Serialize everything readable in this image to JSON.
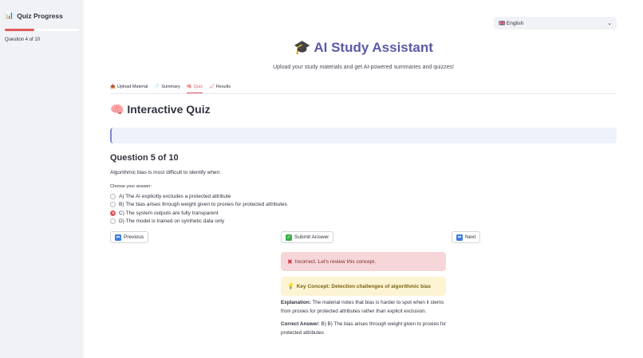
{
  "sidebar": {
    "title": "Quiz Progress",
    "title_icon": "bar-chart-icon",
    "progress_fraction": 0.4,
    "progress_text": "Question 4 of 10"
  },
  "language": {
    "flag": "🇬🇧",
    "selected": "English"
  },
  "header": {
    "icon": "🎓",
    "title": "AI Study Assistant",
    "subtitle": "Upload your study materials and get AI-powered summaries and quizzes!"
  },
  "tabs": [
    {
      "icon": "📤",
      "label": "Upload Material",
      "active": false
    },
    {
      "icon": "📄",
      "label": "Summary",
      "active": false
    },
    {
      "icon": "🧠",
      "label": "Quiz",
      "active": true
    },
    {
      "icon": "📈",
      "label": "Results",
      "active": false
    }
  ],
  "quiz": {
    "section_icon": "🧠",
    "section_title": "Interactive Quiz",
    "question_title": "Question 5 of 10",
    "question_text": "Algorithmic bias is most difficult to identify when:",
    "choose_label": "Choose your answer:",
    "options": [
      "A) The AI explicitly excludes a protected attribute",
      "B) The bias arises through weight given to proxies for protected attributes",
      "C) The system outputs are fully transparent",
      "D) The model is trained on synthetic data only"
    ],
    "selected_index": 2
  },
  "buttons": {
    "previous": "Previous",
    "submit": "Submit Answer",
    "next": "Next"
  },
  "feedback": {
    "error": "Incorrect. Let's review this concept.",
    "key_concept": "Key Concept: Detection challenges of algorithmic bias",
    "explanation_label": "Explanation:",
    "explanation_text": "The material notes that bias is harder to spot when it stems from proxies for protected attributes rather than explicit exclusion.",
    "answer_label": "Correct Answer:",
    "answer_text": "B) B) The bias arises through weight given to proxies for protected attributes"
  },
  "colors": {
    "accent": "#e05b5b",
    "title": "#5a5aa8",
    "sidebar_bg": "#f0f2f6"
  }
}
